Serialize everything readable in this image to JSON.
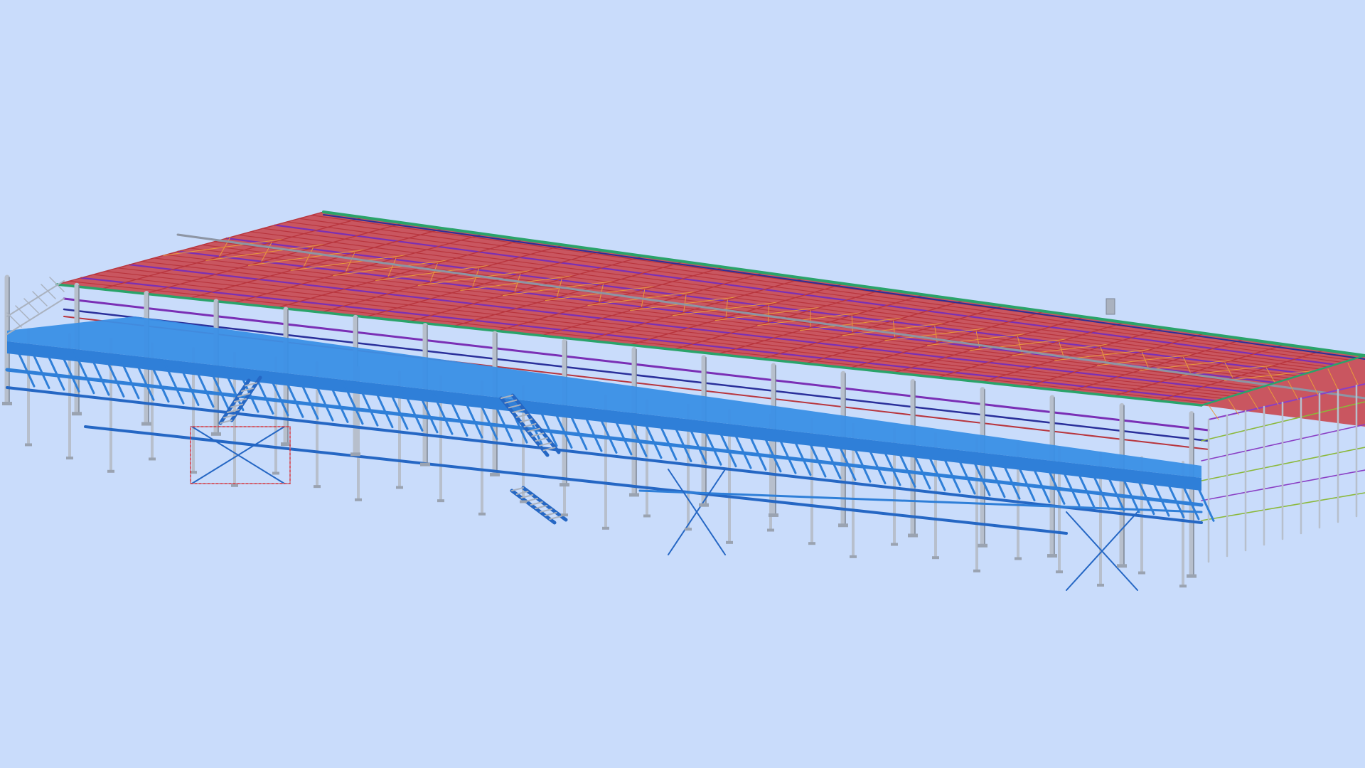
{
  "viewport": {
    "background": "#c9dcfb"
  },
  "model": {
    "colors": {
      "roof_panel": "#c94a52",
      "roof_purlin": "#b8353d",
      "roof_bracing": "#e89a3c",
      "eave_beam": "#2aa36a",
      "roof_beam_purple": "#7a2fb5",
      "roof_beam_navy": "#2a2f9a",
      "ridge_gray": "#8d95a4",
      "platform_steel": "#2f7fd8",
      "platform_deck": "#3a8fe6",
      "column_gray": "#b7bfcc",
      "column_dark": "#7d8694",
      "wall_green": "#8bb83a",
      "wall_purple": "#8a3fc4",
      "stair_blue": "#2567c4",
      "handrail_gray": "#aab2bf",
      "marker_red": "#d9343f",
      "base_plate": "#9aa3b1"
    }
  }
}
